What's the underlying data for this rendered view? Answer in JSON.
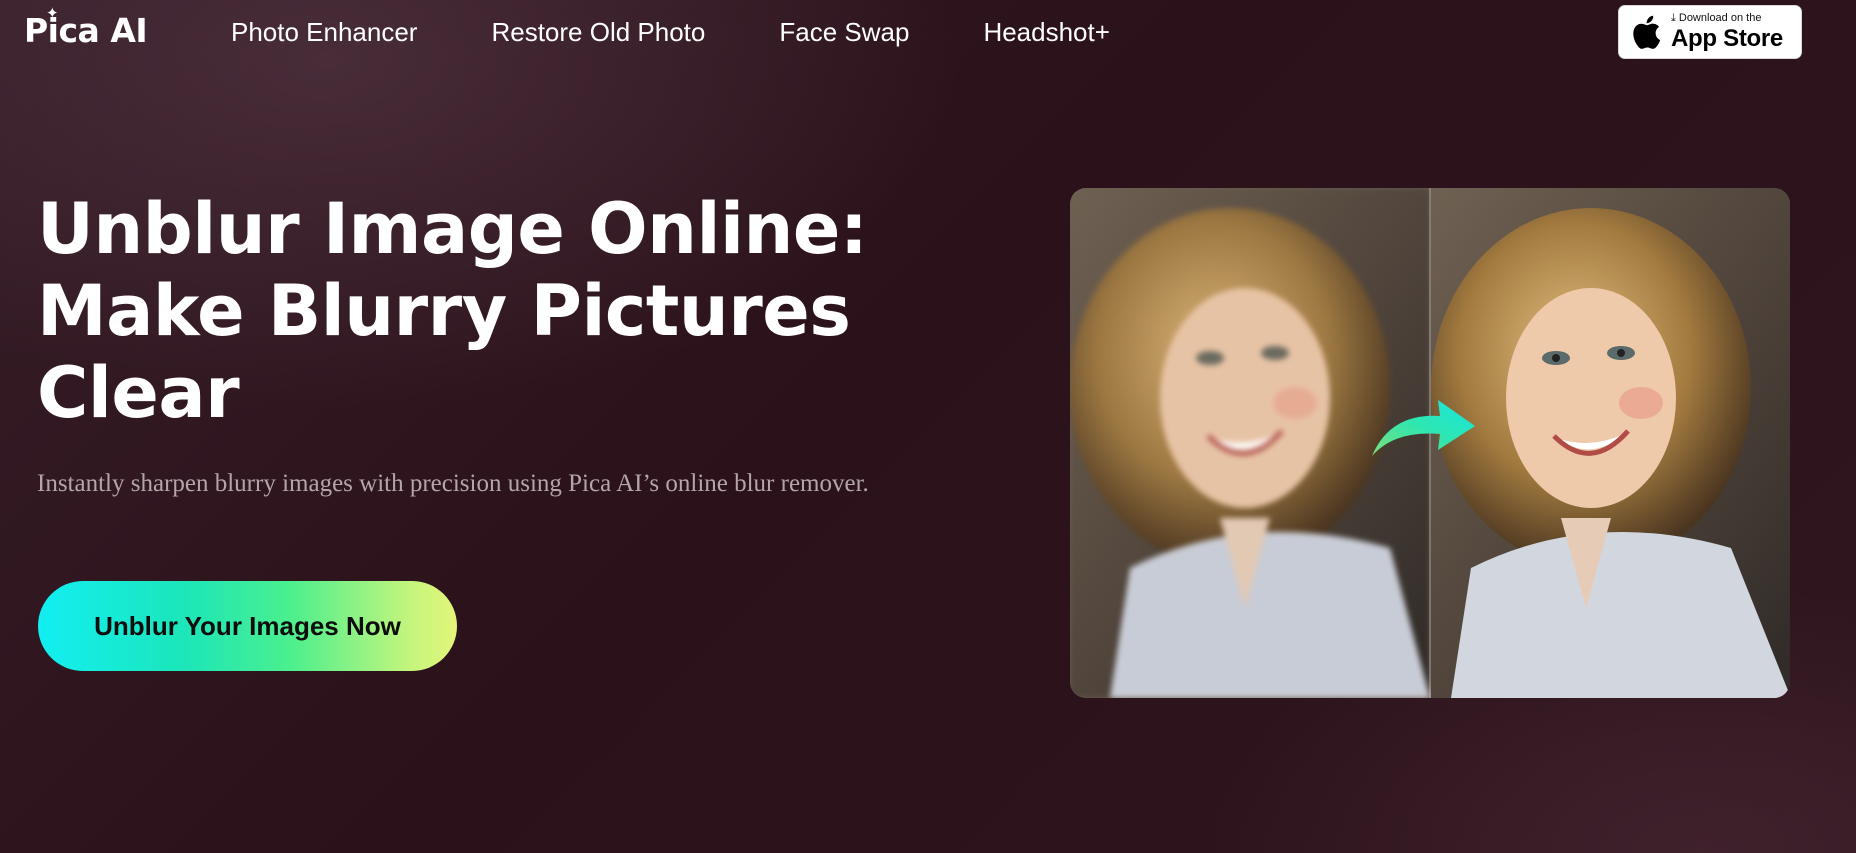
{
  "header": {
    "logo_text": "Pica AI",
    "nav": [
      {
        "label": "Photo Enhancer"
      },
      {
        "label": "Restore Old Photo"
      },
      {
        "label": "Face Swap"
      },
      {
        "label": "Headshot+"
      }
    ],
    "appstore": {
      "small_text": "Download on the",
      "big_text": "App Store",
      "icon": "apple-icon"
    }
  },
  "hero": {
    "title_lines": [
      "Unblur Image Online:",
      "Make Blurry Pictures",
      "Clear"
    ],
    "subtitle": "Instantly sharpen blurry images with precision using Pica AI’s online blur remover.",
    "cta_label": "Unblur Your Images Now"
  },
  "compare": {
    "icon": "arrow-right-icon"
  },
  "colors": {
    "background": "#2b1119",
    "cta_gradient_start": "#12eef2",
    "cta_gradient_end": "#e3f57a",
    "subtitle": "#b4a5ab"
  }
}
